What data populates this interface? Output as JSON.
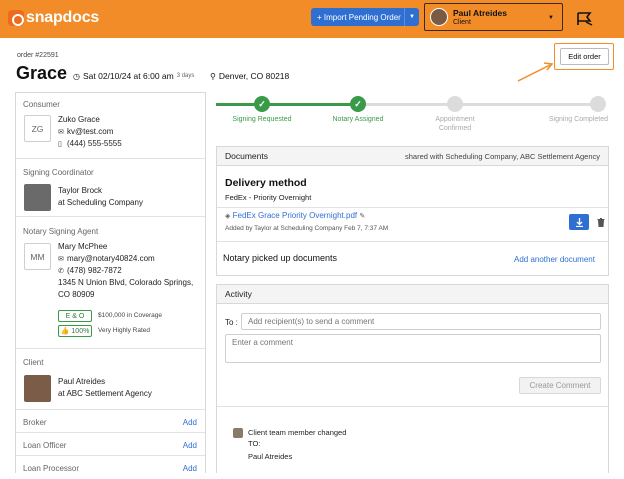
{
  "header": {
    "logo_text": "snapdocs",
    "import_button": "+ Import Pending Order",
    "user_name": "Paul Atreides",
    "user_role": "Client",
    "brand_color": "#f28c28",
    "accent_color": "#2f6fd1"
  },
  "order": {
    "number": "order #22591",
    "title": "Grace",
    "date": "Sat 02/10/24 at 6:00 am",
    "duration": "3 days",
    "location": "Denver, CO 80218",
    "edit_button": "Edit order"
  },
  "sidebar": {
    "consumer": {
      "label": "Consumer",
      "initials": "ZG",
      "name": "Zuko Grace",
      "email": "kv@test.com",
      "phone": "(444) 555-5555"
    },
    "coordinator": {
      "label": "Signing Coordinator",
      "name": "Taylor Brock",
      "company": "at Scheduling Company"
    },
    "agent": {
      "label": "Notary Signing Agent",
      "initials": "MM",
      "name": "Mary McPhee",
      "email": "mary@notary40824.com",
      "phone": "(478) 982-7872",
      "address1": "1345 N Union Blvd, Colorado Springs,",
      "address2": "CO 80909",
      "eo_badge": "E & O",
      "eo_note": "$100,000 in Coverage",
      "rating_badge": "100%",
      "rating_note": "Very Highly Rated"
    },
    "client": {
      "label": "Client",
      "name": "Paul Atreides",
      "company": "at ABC Settlement Agency"
    },
    "rows": [
      {
        "label": "Broker",
        "action": "Add"
      },
      {
        "label": "Loan Officer",
        "action": "Add"
      },
      {
        "label": "Loan Processor",
        "action": "Add"
      }
    ]
  },
  "progress": {
    "steps": [
      {
        "label": "Signing Requested",
        "done": true
      },
      {
        "label": "Notary Assigned",
        "done": true
      },
      {
        "label": "Appointment Confirmed",
        "done": false
      },
      {
        "label": "Signing Completed",
        "done": false
      }
    ]
  },
  "documents": {
    "title": "Documents",
    "shared_with": "shared with Scheduling Company, ABC Settlement Agency",
    "delivery_title": "Delivery method",
    "delivery_value": "FedEx - Priority Overnight",
    "file_name": "FedEx Grace Priority Overnight.pdf",
    "file_meta": "Added by Taylor at Scheduling Company Feb 7, 7:37 AM",
    "notary_status": "Notary picked up documents",
    "add_link": "Add another document"
  },
  "activity": {
    "title": "Activity",
    "to_label": "To :",
    "recipient_placeholder": "Add recipient(s) to send a comment",
    "comment_placeholder": "Enter a comment",
    "create_button": "Create Comment",
    "item_title": "Client team member changed",
    "item_to": "TO:",
    "item_value": "Paul Atreides"
  }
}
